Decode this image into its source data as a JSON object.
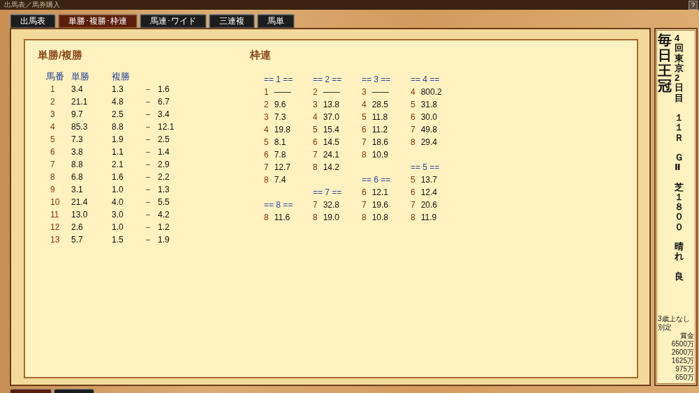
{
  "window": {
    "title": "出馬表／馬券購入",
    "help": "?"
  },
  "tabs": [
    {
      "label": "出馬表",
      "selected": false
    },
    {
      "label": "単勝･複勝･枠連",
      "selected": true
    },
    {
      "label": "馬連･ワイド",
      "selected": false
    },
    {
      "label": "三連複",
      "selected": false
    },
    {
      "label": "馬単",
      "selected": false
    }
  ],
  "win_place": {
    "title": "単勝/複勝",
    "columns": [
      "馬番",
      "単勝",
      "複勝"
    ],
    "rows": [
      {
        "no": "1",
        "win": "3.4",
        "place_min": "1.3",
        "sep": "－",
        "place_max": "1.6"
      },
      {
        "no": "2",
        "win": "21.1",
        "place_min": "4.8",
        "sep": "－",
        "place_max": "6.7"
      },
      {
        "no": "3",
        "win": "9.7",
        "place_min": "2.5",
        "sep": "－",
        "place_max": "3.4"
      },
      {
        "no": "4",
        "win": "85.3",
        "place_min": "8.8",
        "sep": "－",
        "place_max": "12.1"
      },
      {
        "no": "5",
        "win": "7.3",
        "place_min": "1.9",
        "sep": "－",
        "place_max": "2.5"
      },
      {
        "no": "6",
        "win": "3.8",
        "place_min": "1.1",
        "sep": "－",
        "place_max": "1.4"
      },
      {
        "no": "7",
        "win": "8.8",
        "place_min": "2.1",
        "sep": "－",
        "place_max": "2.9"
      },
      {
        "no": "8",
        "win": "6.8",
        "place_min": "1.6",
        "sep": "－",
        "place_max": "2.2"
      },
      {
        "no": "9",
        "win": "3.1",
        "place_min": "1.0",
        "sep": "－",
        "place_max": "1.3"
      },
      {
        "no": "10",
        "win": "21.4",
        "place_min": "4.0",
        "sep": "－",
        "place_max": "5.5"
      },
      {
        "no": "11",
        "win": "13.0",
        "place_min": "3.0",
        "sep": "－",
        "place_max": "4.2"
      },
      {
        "no": "12",
        "win": "2.6",
        "place_min": "1.0",
        "sep": "－",
        "place_max": "1.2"
      },
      {
        "no": "13",
        "win": "5.7",
        "place_min": "1.5",
        "sep": "－",
        "place_max": "1.9"
      }
    ]
  },
  "bracket": {
    "title": "枠連",
    "columns": [
      [
        {
          "kind": "header",
          "text": "== 1 =="
        },
        {
          "kind": "odds",
          "no": "1",
          "odds": "——"
        },
        {
          "kind": "odds",
          "no": "2",
          "odds": "9.6"
        },
        {
          "kind": "odds",
          "no": "3",
          "odds": "7.3"
        },
        {
          "kind": "odds",
          "no": "4",
          "odds": "19.8"
        },
        {
          "kind": "odds",
          "no": "5",
          "odds": "8.1"
        },
        {
          "kind": "odds",
          "no": "6",
          "odds": "7.8"
        },
        {
          "kind": "odds",
          "no": "7",
          "odds": "12.7"
        },
        {
          "kind": "odds",
          "no": "8",
          "odds": "7.4"
        },
        {
          "kind": "gap"
        },
        {
          "kind": "header",
          "text": "== 8 =="
        },
        {
          "kind": "odds",
          "no": "8",
          "odds": "11.6"
        }
      ],
      [
        {
          "kind": "header",
          "text": "== 2 =="
        },
        {
          "kind": "odds",
          "no": "2",
          "odds": "——"
        },
        {
          "kind": "odds",
          "no": "3",
          "odds": "13.8"
        },
        {
          "kind": "odds",
          "no": "4",
          "odds": "37.0"
        },
        {
          "kind": "odds",
          "no": "5",
          "odds": "15.4"
        },
        {
          "kind": "odds",
          "no": "6",
          "odds": "14.5"
        },
        {
          "kind": "odds",
          "no": "7",
          "odds": "24.1"
        },
        {
          "kind": "odds",
          "no": "8",
          "odds": "14.2"
        },
        {
          "kind": "gap"
        },
        {
          "kind": "header",
          "text": "== 7 =="
        },
        {
          "kind": "odds",
          "no": "7",
          "odds": "32.8"
        },
        {
          "kind": "odds",
          "no": "8",
          "odds": "19.0"
        }
      ],
      [
        {
          "kind": "header",
          "text": "== 3 =="
        },
        {
          "kind": "odds",
          "no": "3",
          "odds": "——"
        },
        {
          "kind": "odds",
          "no": "4",
          "odds": "28.5"
        },
        {
          "kind": "odds",
          "no": "5",
          "odds": "11.8"
        },
        {
          "kind": "odds",
          "no": "6",
          "odds": "11.2"
        },
        {
          "kind": "odds",
          "no": "7",
          "odds": "18.6"
        },
        {
          "kind": "odds",
          "no": "8",
          "odds": "10.9"
        },
        {
          "kind": "gap"
        },
        {
          "kind": "header",
          "text": "== 6 =="
        },
        {
          "kind": "odds",
          "no": "6",
          "odds": "12.1"
        },
        {
          "kind": "odds",
          "no": "7",
          "odds": "19.6"
        },
        {
          "kind": "odds",
          "no": "8",
          "odds": "10.8"
        }
      ],
      [
        {
          "kind": "header",
          "text": "== 4 =="
        },
        {
          "kind": "odds",
          "no": "4",
          "odds": "800.2"
        },
        {
          "kind": "odds",
          "no": "5",
          "odds": "31.8"
        },
        {
          "kind": "odds",
          "no": "6",
          "odds": "30.0"
        },
        {
          "kind": "odds",
          "no": "7",
          "odds": "49.8"
        },
        {
          "kind": "odds",
          "no": "8",
          "odds": "29.4"
        },
        {
          "kind": "gap"
        },
        {
          "kind": "header",
          "text": "== 5 =="
        },
        {
          "kind": "odds",
          "no": "5",
          "odds": "13.7"
        },
        {
          "kind": "odds",
          "no": "6",
          "odds": "12.4"
        },
        {
          "kind": "odds",
          "no": "7",
          "odds": "20.6"
        },
        {
          "kind": "odds",
          "no": "8",
          "odds": "11.9"
        }
      ]
    ]
  },
  "race": {
    "name": "毎日王冠",
    "details": [
      "4回東京2日目",
      "１１Ｒ",
      "ＧⅡ",
      "芝１８００",
      "晴れ",
      "良"
    ],
    "conditions": [
      "3歳上なし",
      "別定"
    ],
    "prize_label": "賞金",
    "prizes": [
      "6500万",
      "2600万",
      "1625万",
      "975万",
      "650万"
    ]
  }
}
